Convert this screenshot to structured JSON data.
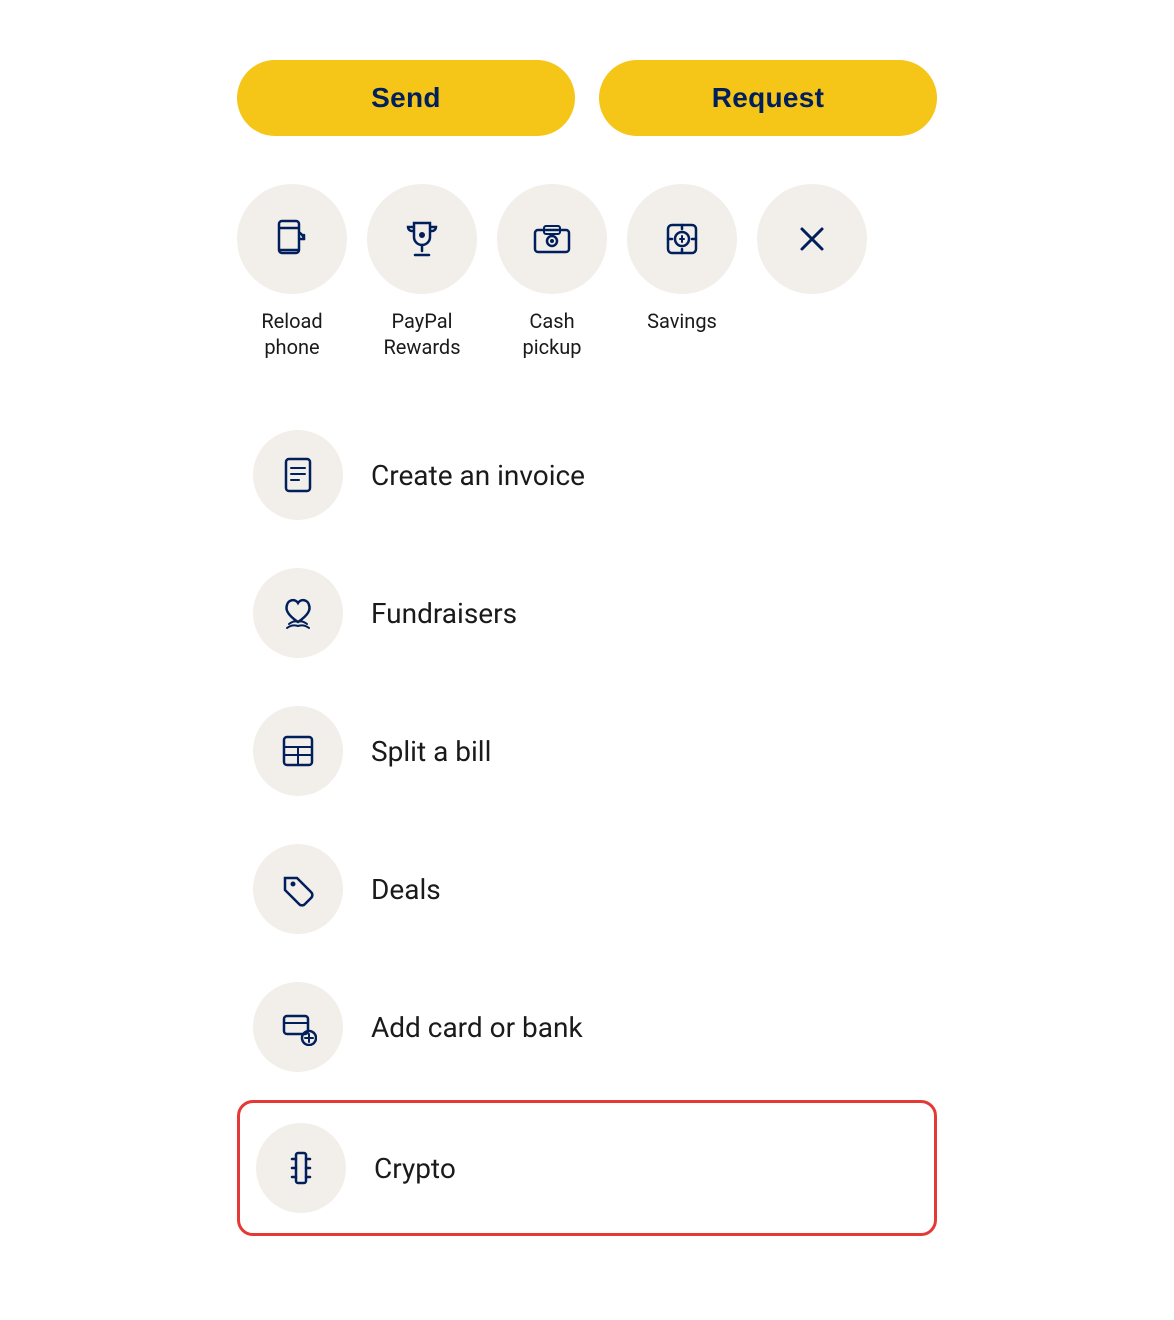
{
  "buttons": {
    "send": "Send",
    "request": "Request"
  },
  "quick_actions": [
    {
      "id": "reload-phone",
      "label": "Reload\nphone",
      "label_display": "Reload phone",
      "icon": "reload-phone-icon"
    },
    {
      "id": "paypal-rewards",
      "label": "PayPal\nRewards",
      "label_display": "PayPal Rewards",
      "icon": "trophy-icon"
    },
    {
      "id": "cash-pickup",
      "label": "Cash\npickup",
      "label_display": "Cash pickup",
      "icon": "cash-pickup-icon"
    },
    {
      "id": "savings",
      "label": "Savings",
      "label_display": "Savings",
      "icon": "savings-icon"
    },
    {
      "id": "close",
      "label": "",
      "label_display": "",
      "icon": "close-icon"
    }
  ],
  "menu_items": [
    {
      "id": "create-invoice",
      "label": "Create an invoice",
      "icon": "invoice-icon",
      "highlighted": false
    },
    {
      "id": "fundraisers",
      "label": "Fundraisers",
      "icon": "fundraisers-icon",
      "highlighted": false
    },
    {
      "id": "split-bill",
      "label": "Split a bill",
      "icon": "split-bill-icon",
      "highlighted": false
    },
    {
      "id": "deals",
      "label": "Deals",
      "icon": "deals-icon",
      "highlighted": false
    },
    {
      "id": "add-card-bank",
      "label": "Add card or bank",
      "icon": "add-bank-icon",
      "highlighted": false
    },
    {
      "id": "crypto",
      "label": "Crypto",
      "icon": "crypto-icon",
      "highlighted": true
    }
  ],
  "colors": {
    "brand_yellow": "#F5C518",
    "brand_dark_blue": "#001F5B",
    "icon_bg": "#F2EFEB",
    "highlight_border": "#e53935"
  }
}
